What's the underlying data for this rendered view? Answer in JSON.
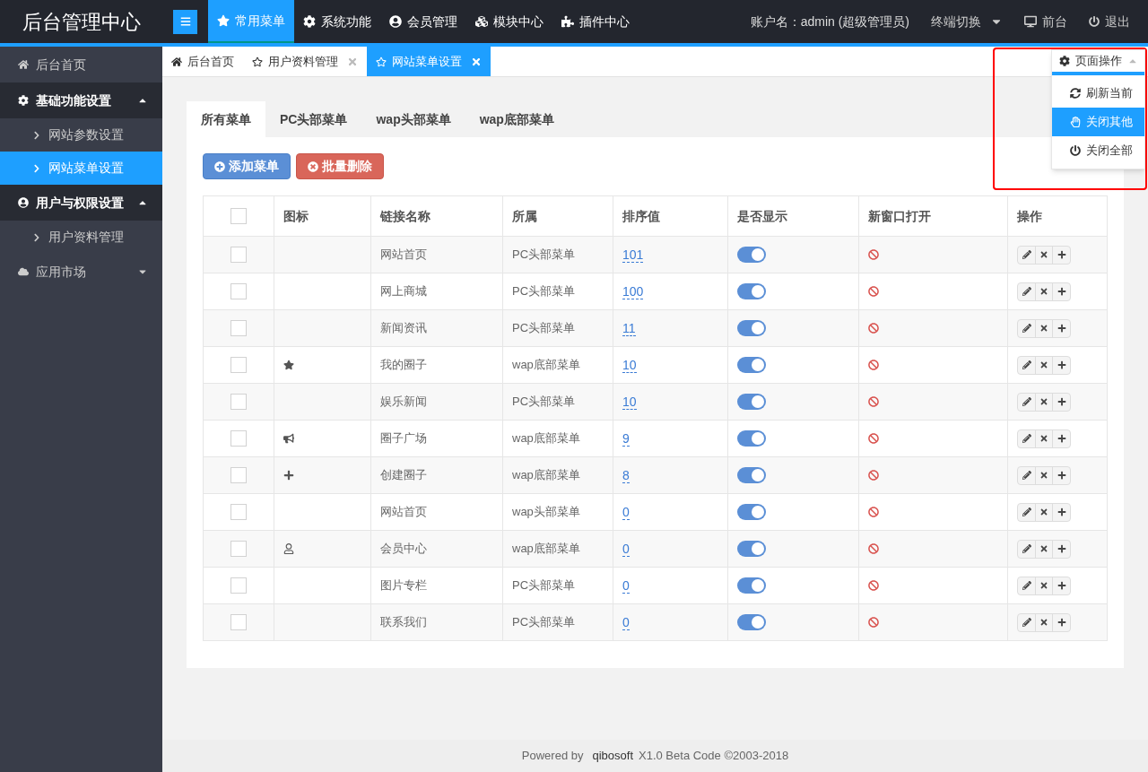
{
  "brand": "后台管理中心",
  "top_nav": [
    {
      "label": "常用菜单",
      "selected": true
    },
    {
      "label": "系统功能",
      "selected": false
    },
    {
      "label": "会员管理",
      "selected": false
    },
    {
      "label": "模块中心",
      "selected": false
    },
    {
      "label": "插件中心",
      "selected": false
    }
  ],
  "account": "账户名：admin (超级管理员)",
  "top_right": [
    {
      "label": "终端切换",
      "kind": "dropdown"
    },
    {
      "label": "前台",
      "kind": "monitor"
    },
    {
      "label": "退出",
      "kind": "power"
    }
  ],
  "sidebar": [
    {
      "label": "后台首页"
    },
    {
      "label": "基础功能设置",
      "expanded": true,
      "children": [
        {
          "label": "网站参数设置",
          "selected": false
        },
        {
          "label": "网站菜单设置",
          "selected": true
        }
      ]
    },
    {
      "label": "用户与权限设置",
      "expanded": true,
      "children": [
        {
          "label": "用户资料管理",
          "selected": false
        }
      ]
    },
    {
      "label": "应用市场",
      "expanded": false
    }
  ],
  "page_tabs": [
    {
      "label": "后台首页",
      "closable": false,
      "selected": false
    },
    {
      "label": "用户资料管理",
      "closable": true,
      "selected": false
    },
    {
      "label": "网站菜单设置",
      "closable": true,
      "selected": true
    }
  ],
  "page_menu": {
    "label": "页面操作",
    "items": [
      {
        "label": "刷新当前",
        "selected": false
      },
      {
        "label": "关闭其他",
        "selected": true
      },
      {
        "label": "关闭全部",
        "selected": false
      }
    ]
  },
  "sub_tabs": [
    {
      "label": "所有菜单",
      "selected": true
    },
    {
      "label": "PC头部菜单",
      "selected": false
    },
    {
      "label": "wap头部菜单",
      "selected": false
    },
    {
      "label": "wap底部菜单",
      "selected": false
    }
  ],
  "buttons": [
    {
      "label": "添加菜单",
      "kind": "add"
    },
    {
      "label": "批量删除",
      "kind": "delete"
    }
  ],
  "table": {
    "select_all_checked": false,
    "columns": [
      "图标",
      "链接名称",
      "所属",
      "排序值",
      "是否显示",
      "新窗口打开",
      "操作"
    ],
    "rows": [
      {
        "checked": false,
        "kind": "none",
        "name": "网站首页",
        "group": "PC头部菜单",
        "order": "101",
        "shown": true,
        "new_window": false
      },
      {
        "checked": false,
        "kind": "none",
        "name": "网上商城",
        "group": "PC头部菜单",
        "order": "100",
        "shown": true,
        "new_window": false
      },
      {
        "checked": false,
        "kind": "none",
        "name": "新闻资讯",
        "group": "PC头部菜单",
        "order": "11",
        "shown": true,
        "new_window": false
      },
      {
        "checked": false,
        "kind": "star",
        "name": "我的圈子",
        "group": "wap底部菜单",
        "order": "10",
        "shown": true,
        "new_window": false
      },
      {
        "checked": false,
        "kind": "none",
        "name": "娱乐新闻",
        "group": "PC头部菜单",
        "order": "10",
        "shown": true,
        "new_window": false
      },
      {
        "checked": false,
        "kind": "bullhorn",
        "name": "圈子广场",
        "group": "wap底部菜单",
        "order": "9",
        "shown": true,
        "new_window": false
      },
      {
        "checked": false,
        "kind": "plus",
        "name": "创建圈子",
        "group": "wap底部菜单",
        "order": "8",
        "shown": true,
        "new_window": false
      },
      {
        "checked": false,
        "kind": "none",
        "name": "网站首页",
        "group": "wap头部菜单",
        "order": "0",
        "shown": true,
        "new_window": false
      },
      {
        "checked": false,
        "kind": "user",
        "name": "会员中心",
        "group": "wap底部菜单",
        "order": "0",
        "shown": true,
        "new_window": false
      },
      {
        "checked": false,
        "kind": "none",
        "name": "图片专栏",
        "group": "PC头部菜单",
        "order": "0",
        "shown": true,
        "new_window": false
      },
      {
        "checked": false,
        "kind": "none",
        "name": "联系我们",
        "group": "PC头部菜单",
        "order": "0",
        "shown": true,
        "new_window": false
      }
    ]
  },
  "footer": {
    "prefix": "Powered by",
    "brand": "qibosoft",
    "suffix": "X1.0 Beta Code ©2003-2018"
  }
}
